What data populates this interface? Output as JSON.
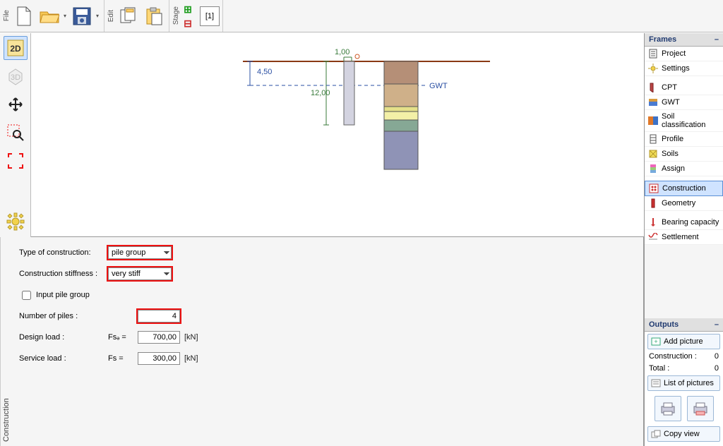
{
  "toolbar": {
    "file_label": "File",
    "edit_label": "Edit",
    "stage_label": "Stage",
    "stage_tab": "[1]"
  },
  "view": {
    "btn_2d": "2D",
    "btn_3d": "3D"
  },
  "frames": {
    "header": "Frames",
    "items": [
      {
        "label": "Project"
      },
      {
        "label": "Settings"
      },
      {
        "label": "CPT"
      },
      {
        "label": "GWT"
      },
      {
        "label": "Soil classification"
      },
      {
        "label": "Profile"
      },
      {
        "label": "Soils"
      },
      {
        "label": "Assign"
      },
      {
        "label": "Construction"
      },
      {
        "label": "Geometry"
      },
      {
        "label": "Bearing capacity"
      },
      {
        "label": "Settlement"
      }
    ],
    "active_index": 8
  },
  "outputs": {
    "header": "Outputs",
    "add_picture": "Add picture",
    "construction_label": "Construction :",
    "construction_count": "0",
    "total_label": "Total :",
    "total_count": "0",
    "list_pictures": "List of pictures",
    "copy_view": "Copy view"
  },
  "canvas_labels": {
    "dim_top": "1,00",
    "dim_vspan": "4,50",
    "dim_pile": "12,00",
    "gwt": "GWT"
  },
  "form": {
    "panel_label": "Construction",
    "type_label": "Type of construction:",
    "type_value": "pile group",
    "stiffness_label": "Construction stiffness :",
    "stiffness_value": "very stiff",
    "input_group_label": "Input pile group",
    "npiles_label": "Number of piles :",
    "npiles_value": "4",
    "design_label": "Design load :",
    "design_sym": "Fsₔ =",
    "design_value": "700,00",
    "design_unit": "[kN]",
    "service_label": "Service load :",
    "service_sym": "Fs  =",
    "service_value": "300,00",
    "service_unit": "[kN]"
  },
  "chart_data": {
    "type": "diagram",
    "ground_level_y": 0,
    "gwt_depth": 4.5,
    "pile_top_spacing": 1.0,
    "pile_length": 12.0,
    "soil_layers": [
      {
        "from": 0.0,
        "to": 3.8,
        "color": "#b58f77"
      },
      {
        "from": 3.8,
        "to": 7.6,
        "color": "#cfb089"
      },
      {
        "from": 7.6,
        "to": 8.4,
        "color": "#e4e089"
      },
      {
        "from": 8.4,
        "to": 9.8,
        "color": "#f3f0a7"
      },
      {
        "from": 9.8,
        "to": 11.8,
        "color": "#86a895"
      },
      {
        "from": 11.8,
        "to": 18.0,
        "color": "#8f93b6"
      }
    ],
    "ylim": [
      0,
      18
    ]
  }
}
